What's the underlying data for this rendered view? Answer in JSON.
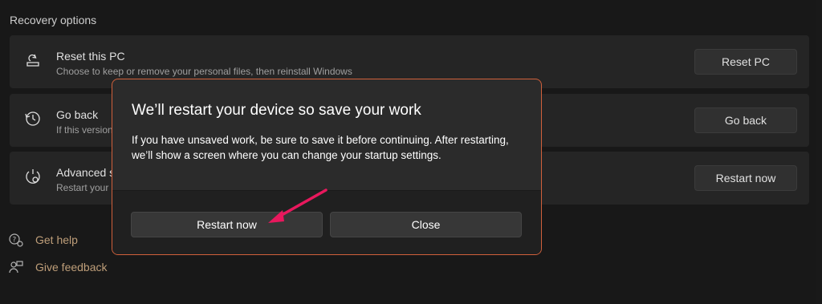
{
  "section_title": "Recovery options",
  "cards": [
    {
      "icon": "reset-pc-icon",
      "title": "Reset this PC",
      "desc": "Choose to keep or remove your personal files, then reinstall Windows",
      "button": "Reset PC"
    },
    {
      "icon": "history-icon",
      "title": "Go back",
      "desc": "If this version",
      "button": "Go back"
    },
    {
      "icon": "advanced-startup-icon",
      "title": "Advanced s",
      "desc": "Restart your",
      "button": "Restart now"
    }
  ],
  "links": [
    {
      "icon": "help-icon",
      "label": "Get help"
    },
    {
      "icon": "feedback-icon",
      "label": "Give feedback"
    }
  ],
  "dialog": {
    "title": "We’ll restart your device so save your work",
    "body": "If you have unsaved work, be sure to save it before continuing. After restarting, we’ll show a screen where you can change your startup settings.",
    "primary_button": "Restart now",
    "secondary_button": "Close"
  },
  "colors": {
    "background": "#1c1c1c",
    "card": "#2b2b2b",
    "dialog_border": "#d0603b",
    "link_text": "#d9b48a",
    "arrow": "#e8185d"
  }
}
